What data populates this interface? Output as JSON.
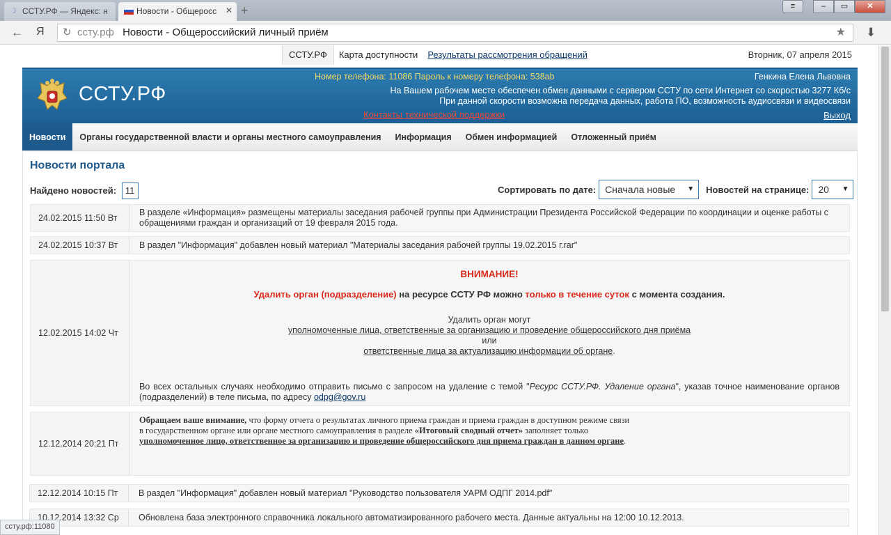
{
  "browser": {
    "tabs": [
      {
        "title": "ССТУ.РФ — Яндекс: н",
        "active": false
      },
      {
        "title": "Новости - Общеросс",
        "active": true
      }
    ],
    "new_tab": "+",
    "window_controls": {
      "menu": "≡",
      "minimize": "–",
      "maximize": "▭",
      "close": "✕"
    },
    "back": "←",
    "yandex": "Я",
    "reload": "↻",
    "url_domain": "ссту.рф",
    "url_title": "Новости - Общероссийский личный приём",
    "bookmark": "★",
    "downloads": "⬇",
    "status_text": "ссту.рф:11080"
  },
  "toplinks": {
    "home": "ССТУ.РФ",
    "map": "Карта доступности",
    "results": "Результаты рассмотрения обращений",
    "date": "Вторник, 07 апреля 2015"
  },
  "banner": {
    "brand": "ССТУ.РФ",
    "phone": "Номер телефона: 11086 Пароль к номеру телефона: 538ab",
    "user": "Генкина Елена Львовна",
    "line2": "На Вашем рабочем месте обеспечен обмен данными с сервером ССТУ по сети Интернет со скоростью 3277 Кб/с",
    "line3": "При данной скорости возможна передача данных, работа ПО, возможность аудиосвязи и видеосвязи",
    "support": "Контакты технической поддержки",
    "logout": "Выход"
  },
  "nav": [
    "Новости",
    "Органы государственной власти и органы местного самоуправления",
    "Информация",
    "Обмен информацией",
    "Отложенный приём"
  ],
  "main": {
    "heading": "Новости портала",
    "found_label": "Найдено новостей:",
    "found_count": "11",
    "sort_label": "Сортировать по дате:",
    "sort_value": "Сначала новые",
    "per_page_label": "Новостей на странице:",
    "per_page_value": "20"
  },
  "news": [
    {
      "date": "24.02.2015 11:50 Вт",
      "text": "В разделе «Информация» размещены материалы заседания рабочей группы при Администрации Президента Российской Федерации по координации и оценке работы с  обращениями граждан и организаций от 19 февраля 2015 года."
    },
    {
      "date": "24.02.2015 10:37 Вт",
      "text": "В раздел \"Информация\" добавлен новый материал \"Материалы заседания рабочей группы 19.02.2015 г.rar\""
    },
    {
      "date": "12.02.2015 14:02 Чт",
      "warn_title": "ВНИМАНИЕ!",
      "warn_a": "Удалить орган (подразделение)",
      "warn_b": " на ресурсе ССТУ РФ можно ",
      "warn_c": "только в течение суток",
      "warn_d": " с момента создания.",
      "who": "Удалить орган могут",
      "who1": "уполномоченные лица, ответственные за организацию и проведение общероссийского дня приёма",
      "or": "или",
      "who2": "ответственные лица за актуализацию информации об органе",
      "dot": ".",
      "other_a": "Во всех остальных случаях необходимо отправить письмо с запросом на удаление с темой \"",
      "other_topic": "Ресурс ССТУ.РФ. Удаление органа",
      "other_b": "\", указав точное наименование органов (подразделений) в теле письма, по адресу ",
      "email": "odpg@gov.ru"
    },
    {
      "date": "12.12.2014 20:21 Пт",
      "p1_bold": "Обращаем ваше внимание,",
      "p1": " что форму отчета о результатах личного приема граждан и приема граждан в доступном режиме связи",
      "p2": "в государственном органе или органе местного самоуправления в разделе ",
      "p2_bold": "«Итоговый сводный отчет»",
      "p2b": " заполняет только",
      "p3_bold": "уполномоченное лицо, ответственное за организацию и проведение общероссийского дня приема граждан в данном органе",
      "p3_end": "."
    },
    {
      "date": "12.12.2014 10:15 Пт",
      "text": "В раздел \"Информация\" добавлен новый материал \"Руководство пользователя УАРМ ОДПГ 2014.pdf\""
    },
    {
      "date": "10.12.2014 13:32 Ср",
      "text": "Обновлена база электронного справочника локального автоматизированного рабочего места. Данные актуальны на 12:00 10.12.2013."
    }
  ]
}
